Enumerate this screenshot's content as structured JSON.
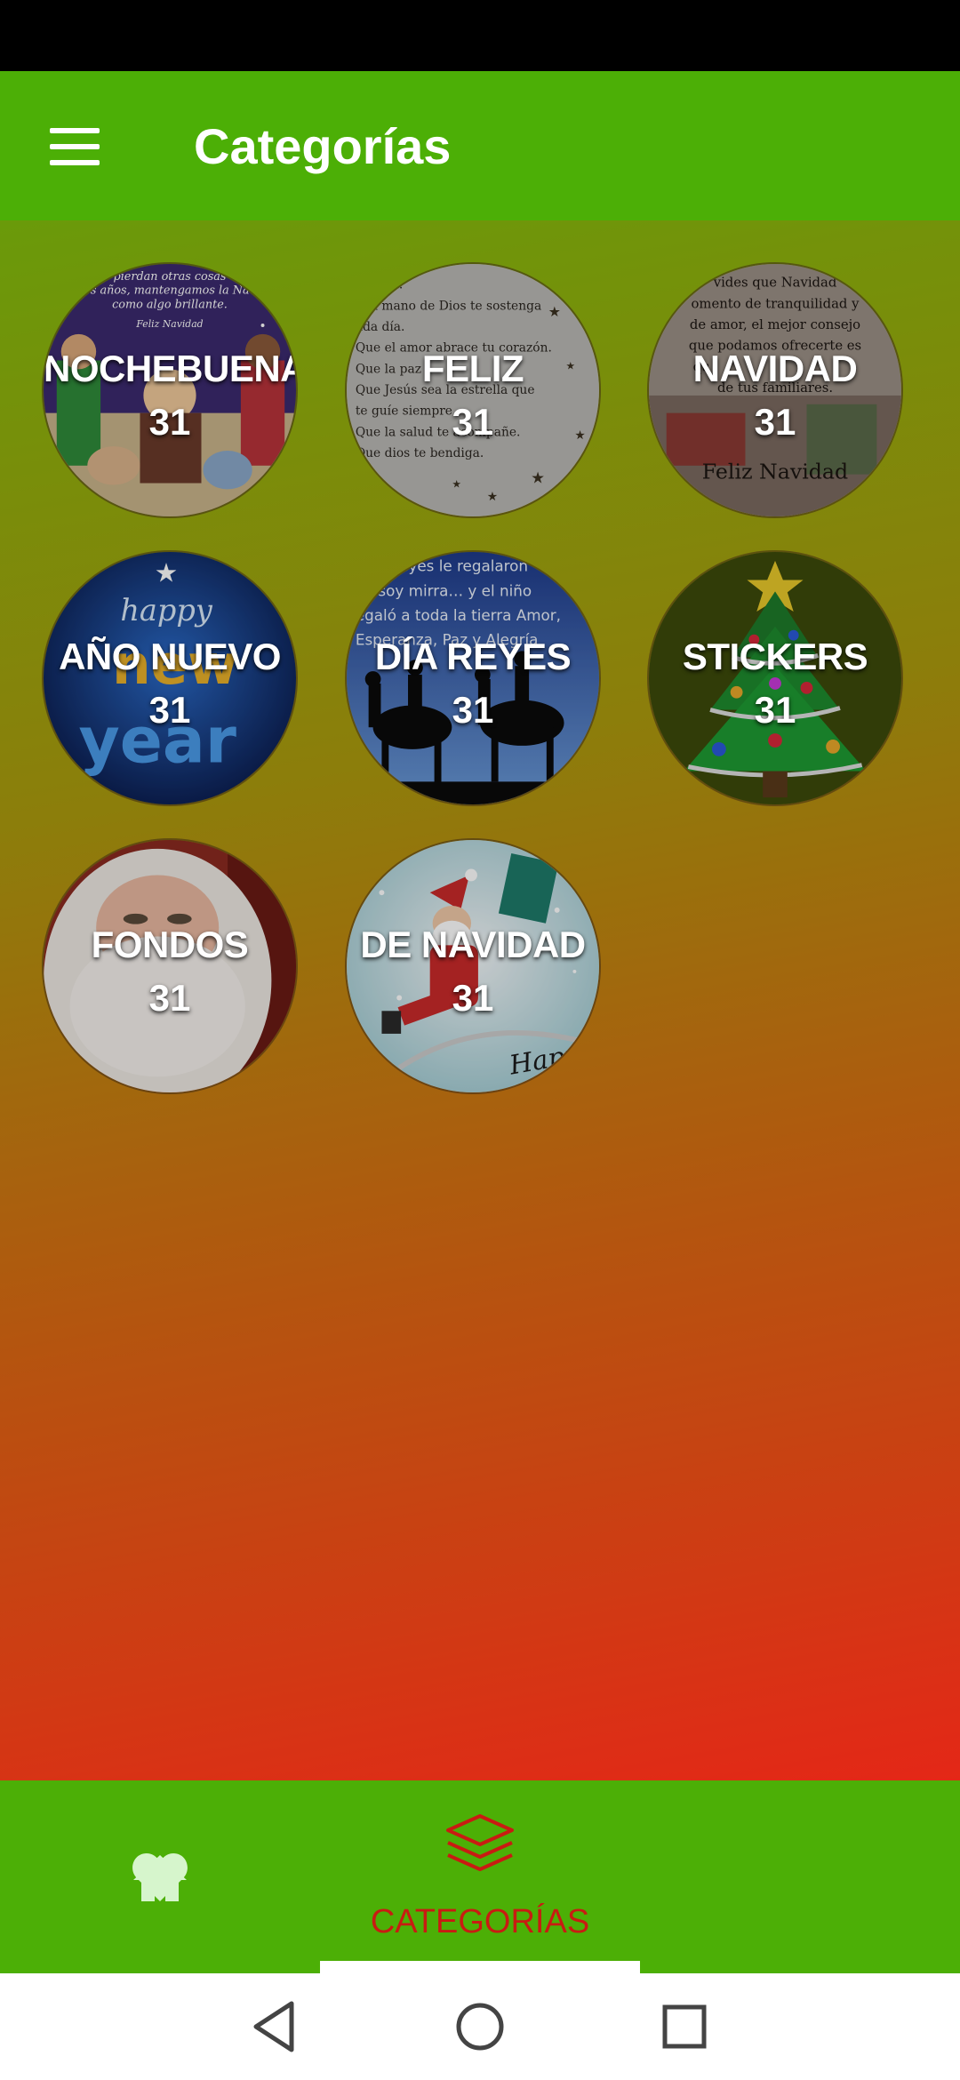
{
  "app_bar": {
    "title": "Categorías",
    "menu_icon": "hamburger-menu-icon"
  },
  "categories": [
    {
      "name": "NOCHEBUENA",
      "count": "31",
      "image_text": [
        "pierdan otras cosas",
        "os años, mantengamos la Nav",
        "como algo brillante.",
        "Feliz Navidad"
      ]
    },
    {
      "name": "FELIZ",
      "count": "31",
      "image_text": [
        "ra ti:",
        "e la mano de Dios te sostenga",
        "ada día.",
        "Que el amor abrace tu corazón.",
        "Que la paz",
        "Que Jesús sea la estrella que",
        "te guíe siempre",
        "Que la salud te acompañe.",
        "Que dios te bendiga."
      ]
    },
    {
      "name": "NAVIDAD",
      "count": "31",
      "image_text": [
        "vides que Navidad",
        "omento de tranquilidad y",
        "de amor, el mejor consejo",
        "que podamos ofrecerte es",
        "qu",
        "de tus familiares.",
        "Feliz Navidad"
      ]
    },
    {
      "name": "AÑO NUEVO",
      "count": "31",
      "image_text": [
        "happy",
        "new",
        "year"
      ]
    },
    {
      "name": "DÍA REYES",
      "count": "31",
      "image_text": [
        "eyes le regalaron",
        "iensoy mirra… y el niño",
        "egaló a toda la tierra Amor,",
        "Esperanza, Paz y Alegría"
      ]
    },
    {
      "name": "STICKERS",
      "count": "31",
      "image_text": []
    },
    {
      "name": "FONDOS",
      "count": "31",
      "image_text": []
    },
    {
      "name": "DE NAVIDAD",
      "count": "31",
      "image_text": [
        "Happy"
      ]
    }
  ],
  "bottom_nav": {
    "items": [
      {
        "icon": "home-icon",
        "label": ""
      },
      {
        "icon": "layers-icon",
        "label": "CATEGORÍAS"
      },
      {
        "icon": "heart-icon",
        "label": ""
      }
    ],
    "active_index": 1,
    "active_color": "#c91b12"
  },
  "colors": {
    "app_bar": "#4caf06",
    "gradient_top": "#6a9a0a",
    "gradient_bottom": "#e42717"
  }
}
